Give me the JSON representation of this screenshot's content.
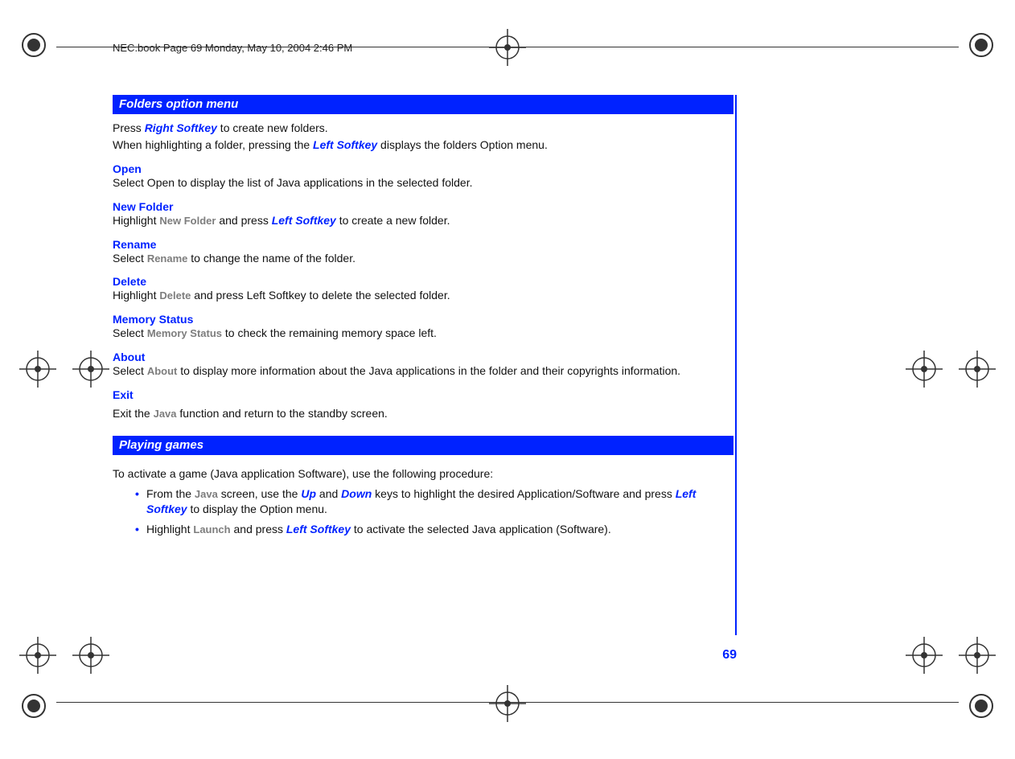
{
  "header": {
    "breadcrumb": "NEC.book  Page 69  Monday, May 10, 2004  2:46 PM"
  },
  "page_number": "69",
  "sections": {
    "folders": {
      "title": "Folders option menu",
      "intro": {
        "p1_pre": "Press ",
        "p1_kw": "Right Softkey",
        "p1_post": " to create new folders.",
        "p2_pre": "When highlighting a folder, pressing the ",
        "p2_kw": "Left Softkey",
        "p2_post": " displays the folders Option menu."
      },
      "open": {
        "h": "Open",
        "p": "Select Open to display the list of Java applications in the selected folder."
      },
      "new_folder": {
        "h": "New Folder",
        "pre": "Highlight ",
        "kw": "New Folder",
        "mid": " and press ",
        "kw2": "Left Softkey",
        "post": " to create a new folder."
      },
      "rename": {
        "h": "Rename",
        "pre": "Select ",
        "kw": "Rename",
        "post": " to change the name of the folder."
      },
      "delete_": {
        "h": "Delete",
        "pre": "Highlight ",
        "kw": "Delete",
        "post": " and press Left Softkey to delete the selected folder."
      },
      "memory": {
        "h": "Memory Status",
        "pre": "Select ",
        "kw": "Memory Status",
        "post": " to check the remaining memory space left."
      },
      "about": {
        "h": "About",
        "pre": "Select ",
        "kw": "About",
        "post": " to display more information about the Java applications in the folder and their copyrights information."
      },
      "exit": {
        "h": "Exit",
        "pre": "Exit the ",
        "kw": "Java",
        "post": " function and return to the standby screen."
      }
    },
    "playing": {
      "title": "Playing games",
      "intro": "To activate a game (Java application Software), use the following procedure:",
      "b1": {
        "t1": "From the ",
        "kw_java": "Java",
        "t2": " screen, use the ",
        "kw_up": "Up",
        "t3": " and ",
        "kw_down": "Down",
        "t4": " keys to highlight the desired Application/Software and press ",
        "kw_left": "Left Softkey",
        "t5": " to display the Option menu."
      },
      "b2": {
        "t1": "Highlight ",
        "kw_launch": "Launch",
        "t2": " and press ",
        "kw_left": "Left Softkey",
        "t3": " to activate the selected Java application (Software)."
      }
    }
  }
}
